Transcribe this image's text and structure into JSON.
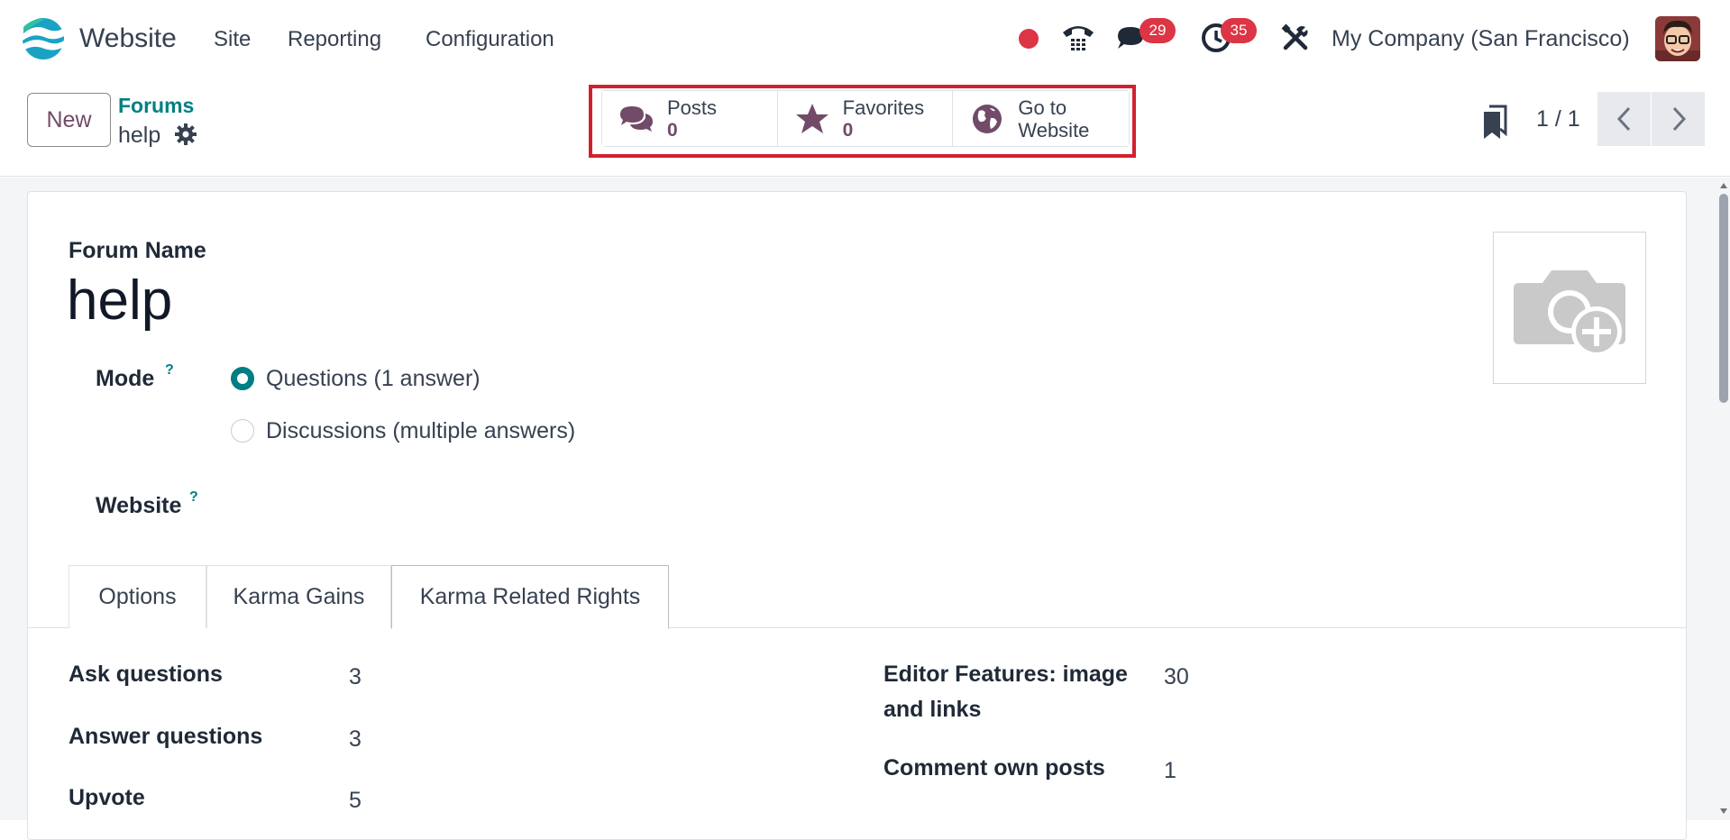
{
  "navbar": {
    "app_name": "Website",
    "menus": [
      "Site",
      "Reporting",
      "Configuration"
    ],
    "messages_badge": "29",
    "activities_badge": "35",
    "company": "My Company (San Francisco)",
    "icons": [
      "website-logo-icon",
      "recording-dot-icon",
      "phone-icon",
      "chat-icon",
      "clock-icon",
      "tools-icon",
      "user-avatar"
    ]
  },
  "control": {
    "new_button": "New",
    "breadcrumb_parent": "Forums",
    "breadcrumb_current": "help",
    "smart_buttons": [
      {
        "label": "Posts",
        "value": "0",
        "icon": "comments-icon"
      },
      {
        "label": "Favorites",
        "value": "0",
        "icon": "star-icon"
      },
      {
        "label_line1": "Go to",
        "label_line2": "Website",
        "icon": "globe-icon"
      }
    ],
    "pager": "1 / 1"
  },
  "form": {
    "name_caption": "Forum Name",
    "name_value": "help",
    "mode_label": "Mode",
    "mode_help": "?",
    "mode_options": [
      {
        "label": "Questions (1 answer)",
        "selected": true
      },
      {
        "label": "Discussions (multiple answers)",
        "selected": false
      }
    ],
    "website_label": "Website",
    "website_help": "?"
  },
  "tabs": [
    "Options",
    "Karma Gains",
    "Karma Related Rights"
  ],
  "active_tab": "Karma Related Rights",
  "karma_rights": {
    "left": [
      {
        "label": "Ask questions",
        "value": "3"
      },
      {
        "label": "Answer questions",
        "value": "3"
      },
      {
        "label": "Upvote",
        "value": "5"
      }
    ],
    "right": [
      {
        "label_line1": "Editor Features: image",
        "label_line2": "and links",
        "value": "30"
      },
      {
        "label": "Comment own posts",
        "value": "1"
      }
    ]
  },
  "colors": {
    "brand": "#714b67",
    "accent": "#017e84",
    "badge": "#dc3545",
    "highlight": "#d3202f"
  }
}
